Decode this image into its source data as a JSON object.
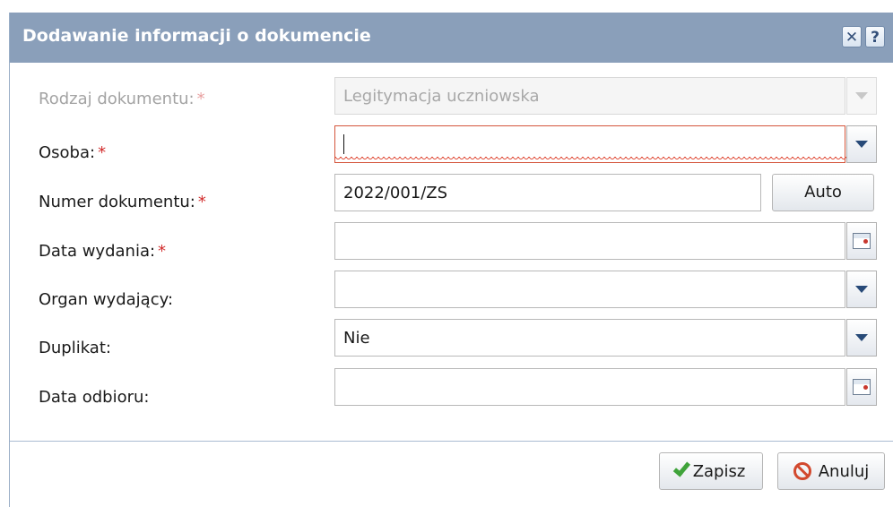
{
  "dialog": {
    "title": "Dodawanie informacji o dokumencie",
    "close_icon": "close-icon",
    "help_label": "?"
  },
  "form": {
    "rodzaj": {
      "label": "Rodzaj dokumentu:",
      "required": "*",
      "value": "Legitymacja uczniowska",
      "disabled": true
    },
    "osoba": {
      "label": "Osoba:",
      "required": "*",
      "value": "",
      "state": "invalid"
    },
    "numer": {
      "label": "Numer dokumentu:",
      "required": "*",
      "value": "2022/001/ZS",
      "button": "Auto"
    },
    "data_wydania": {
      "label": "Data wydania:",
      "required": "*",
      "value": ""
    },
    "organ": {
      "label": "Organ wydający:",
      "value": ""
    },
    "duplikat": {
      "label": "Duplikat:",
      "value": "Nie"
    },
    "data_odbioru": {
      "label": "Data odbioru:",
      "value": ""
    }
  },
  "footer": {
    "save_label": "Zapisz",
    "cancel_label": "Anuluj"
  },
  "colors": {
    "titlebar": "#8a9fba",
    "required": "#d22b2b",
    "error": "#d4553b"
  }
}
